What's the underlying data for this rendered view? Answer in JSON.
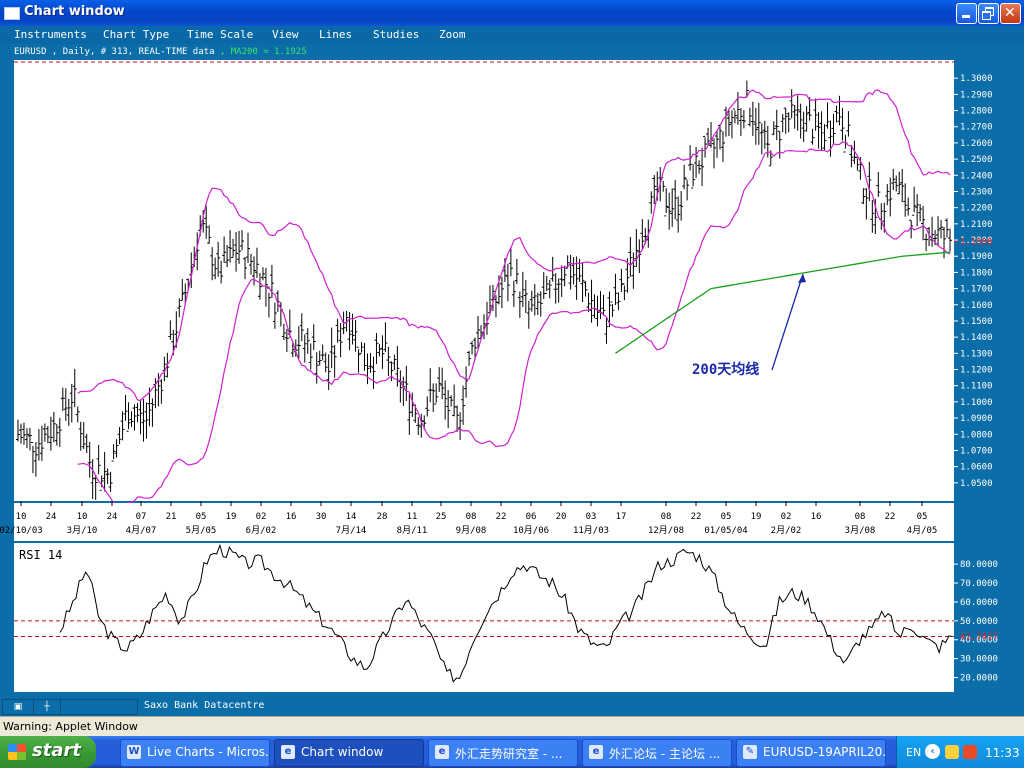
{
  "window": {
    "title": "Chart window"
  },
  "menu": [
    "Instruments",
    "Chart Type",
    "Time Scale",
    "View",
    "Lines",
    "Studies",
    "Zoom"
  ],
  "info": {
    "prefix": "EURUSD , Daily, # 313, REAL-TIME data",
    "sep": " , ",
    "ma": "MA200 = 1.1925"
  },
  "price_axis": [
    "1.3000",
    "1.2900",
    "1.2800",
    "1.2700",
    "1.2600",
    "1.2500",
    "1.2400",
    "1.2300",
    "1.2200",
    "1.2100",
    "1.2000",
    "1.1900",
    "1.1800",
    "1.1700",
    "1.1600",
    "1.1500",
    "1.1400",
    "1.1300",
    "1.1200",
    "1.1100",
    "1.1000",
    "1.0900",
    "1.0800",
    "1.0700",
    "1.0600",
    "1.0500"
  ],
  "current_price": "1.1990",
  "date_days": [
    "10",
    "24",
    "10",
    "24",
    "07",
    "21",
    "05",
    "19",
    "02",
    "16",
    "30",
    "14",
    "28",
    "11",
    "25",
    "08",
    "22",
    "06",
    "20",
    "03",
    "17",
    "08",
    "22",
    "05",
    "19",
    "02",
    "16",
    "08",
    "22",
    "05"
  ],
  "date_months": [
    "02/10/03",
    "3月/10",
    "4月/07",
    "5月/05",
    "6月/02",
    "7月/14",
    "8月/11",
    "9月/08",
    "10月/06",
    "11月/03",
    "12月/08",
    "01/05/04",
    "2月/02",
    "3月/08",
    "4月/05"
  ],
  "annotation": "200天均线",
  "rsi": {
    "label": "RSI 14",
    "axis": [
      "80.0000",
      "70.0000",
      "60.0000",
      "50.0000",
      "40.0000",
      "30.0000",
      "20.0000"
    ],
    "current": "41.7417"
  },
  "bottom": {
    "source": "Saxo Bank Datacentre"
  },
  "warning": "Warning: Applet Window",
  "taskbar": {
    "start": "start",
    "items": [
      "Live Charts - Micros...",
      "Chart window",
      "外汇走势研究室 - ...",
      "外汇论坛 - 主论坛 ...",
      "EURUSD-19APRIL20..."
    ],
    "lang": "EN",
    "clock": "11:33"
  },
  "colors": {
    "menu_bg": "#0a68a6",
    "bands": "#d020d0",
    "ma200": "#1ca01c",
    "price_label": "#e02020",
    "dashed": "#c01010",
    "arrow": "#1a2aa8"
  },
  "chart_data": [
    {
      "type": "ohlc",
      "title": "EURUSD , Daily",
      "ylim": [
        1.04,
        1.31
      ],
      "series": [
        {
          "name": "price (close, sampled)",
          "values": [
            1.08,
            1.074,
            1.085,
            1.105,
            1.06,
            1.055,
            1.095,
            1.088,
            1.12,
            1.16,
            1.21,
            1.18,
            1.195,
            1.185,
            1.165,
            1.14,
            1.135,
            1.12,
            1.155,
            1.125,
            1.13,
            1.11,
            1.09,
            1.11,
            1.085,
            1.14,
            1.16,
            1.18,
            1.155,
            1.165,
            1.185,
            1.17,
            1.15,
            1.165,
            1.2,
            1.23,
            1.22,
            1.245,
            1.255,
            1.275,
            1.285,
            1.255,
            1.275,
            1.275,
            1.265,
            1.28,
            1.24,
            1.22,
            1.235,
            1.215,
            1.205,
            1.2
          ]
        },
        {
          "name": "MA200",
          "values": [
            1.13,
            1.15,
            1.17,
            1.175,
            1.18,
            1.185,
            1.19,
            1.1925
          ]
        }
      ]
    },
    {
      "type": "line",
      "title": "RSI 14",
      "ylim": [
        15,
        88
      ],
      "series": [
        {
          "name": "RSI 14",
          "values": [
            45,
            60,
            78,
            50,
            40,
            35,
            42,
            55,
            65,
            50,
            62,
            82,
            88,
            85,
            80,
            82,
            75,
            70,
            63,
            55,
            48,
            40,
            30,
            25,
            38,
            50,
            62,
            50,
            40,
            22,
            20,
            40,
            55,
            65,
            77,
            80,
            74,
            70,
            60,
            45,
            38,
            35,
            48,
            55,
            67,
            80,
            82,
            87,
            84,
            75,
            60,
            48,
            42,
            37,
            60,
            65,
            62,
            52,
            38,
            27,
            40,
            46,
            55,
            42,
            48,
            40,
            36,
            41.7417
          ]
        }
      ]
    }
  ]
}
